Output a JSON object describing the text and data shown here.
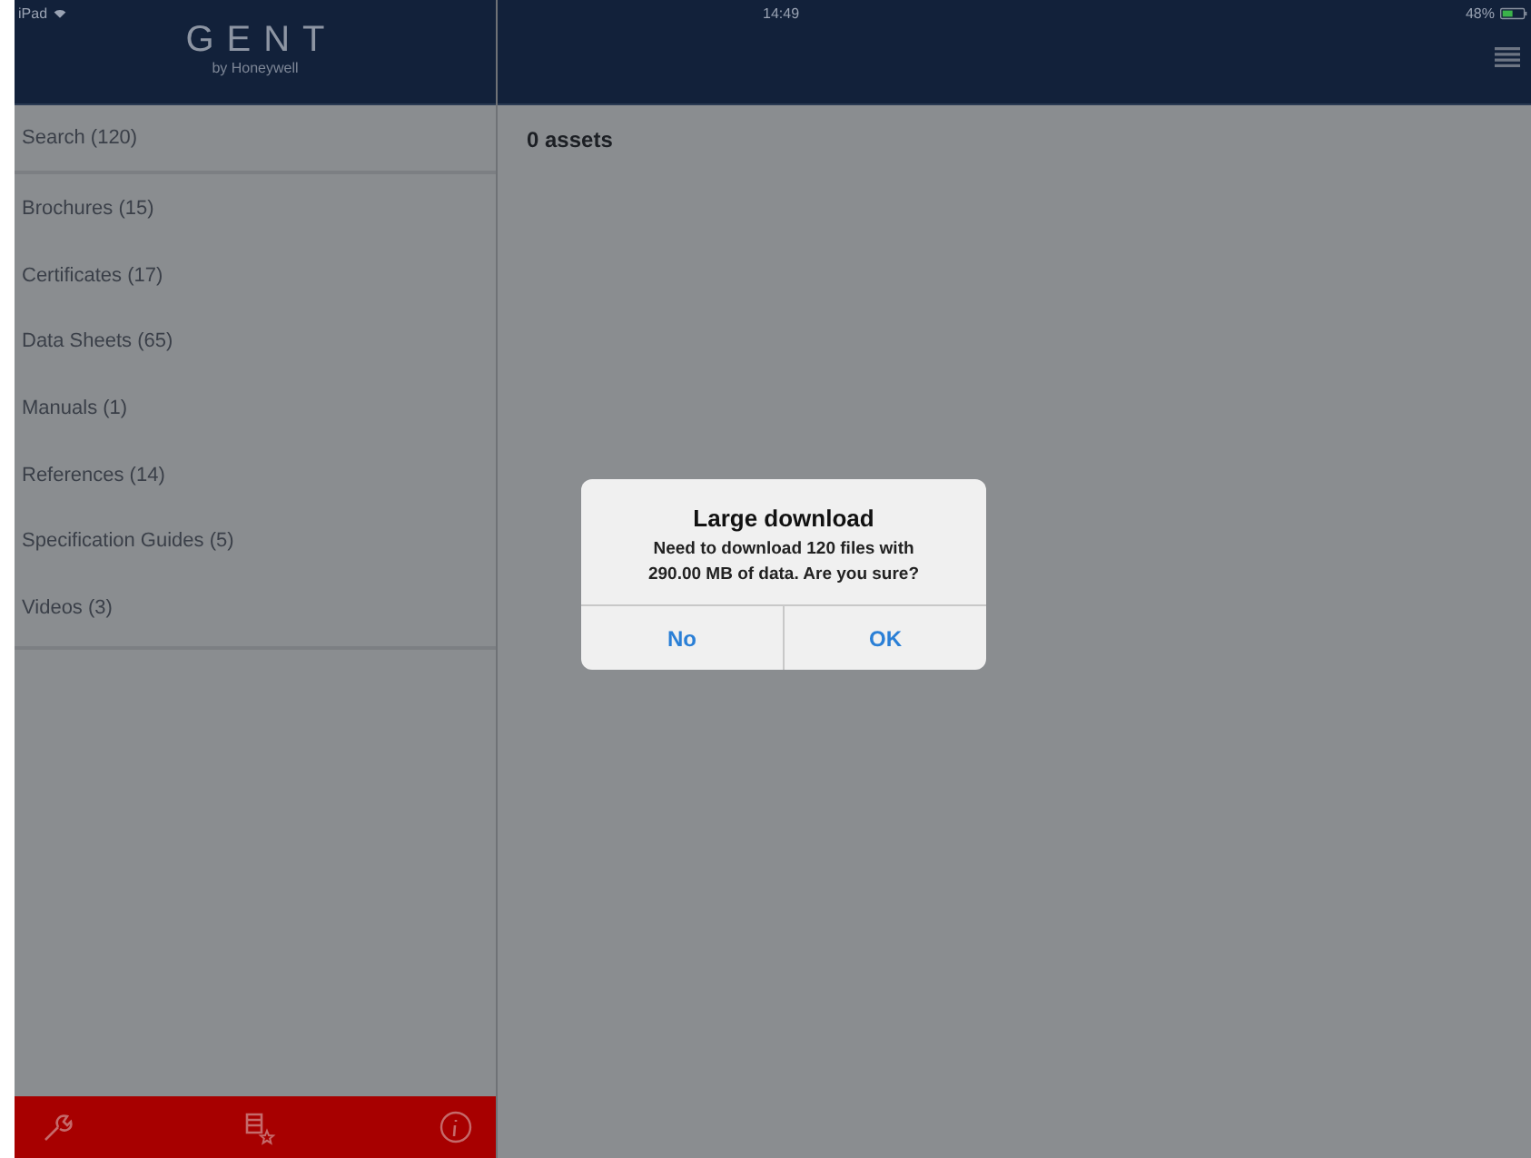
{
  "status_bar": {
    "device": "iPad",
    "time": "14:49",
    "battery": "48%"
  },
  "logo": {
    "title": "GENT",
    "subtitle": "by Honeywell"
  },
  "sidebar": {
    "search": "Search (120)",
    "items": [
      "Brochures (15)",
      "Certificates (17)",
      "Data Sheets (65)",
      "Manuals (1)",
      "References (14)",
      "Specification Guides (5)",
      "Videos (3)"
    ]
  },
  "main": {
    "asset_count": "0 assets"
  },
  "dialog": {
    "title": "Large download",
    "message": "Need to download 120 files with 290.00 MB of data. Are you sure?",
    "buttons": [
      "No",
      "OK"
    ]
  }
}
